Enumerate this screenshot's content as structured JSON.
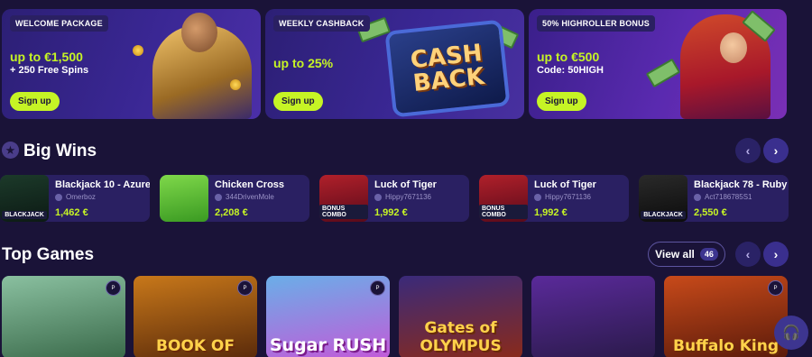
{
  "promos": [
    {
      "tag": "WELCOME PACKAGE",
      "headline": "up to €1,500",
      "subline": "+ 250 Free Spins",
      "button": "Sign up"
    },
    {
      "tag": "WEEKLY CASHBACK",
      "headline": "up to 25%",
      "subline": "",
      "button": "Sign up",
      "art_text": [
        "CASH",
        "BACK"
      ]
    },
    {
      "tag": "50% HIGHROLLER BONUS",
      "headline": "up to €500",
      "subline": "Code: 50HIGH",
      "button": "Sign up"
    }
  ],
  "big_wins": {
    "title": "Big Wins",
    "icon": "star-icon",
    "items": [
      {
        "game": "Blackjack 10 - Azure",
        "user": "Omerboz",
        "amount": "1,462 €",
        "thumb_label": "BLACKJACK"
      },
      {
        "game": "Chicken Cross",
        "user": "344DrivenMole",
        "amount": "2,208 €",
        "thumb_label": ""
      },
      {
        "game": "Luck of Tiger",
        "user": "Hippy7671136",
        "amount": "1,992 €",
        "thumb_label": "BONUS COMBO"
      },
      {
        "game": "Luck of Tiger",
        "user": "Hippy7671136",
        "amount": "1,992 €",
        "thumb_label": "BONUS COMBO"
      },
      {
        "game": "Blackjack 78 - Ruby",
        "user": "Act7186785S1",
        "amount": "2,550 €",
        "thumb_label": "BLACKJACK"
      }
    ]
  },
  "top_games": {
    "title": "Top Games",
    "view_all": "View all",
    "count": "46",
    "tiles": [
      {
        "title": "",
        "badge": "P"
      },
      {
        "title": "BOOK OF",
        "badge": "P"
      },
      {
        "title": "Sugar RUSH",
        "badge": "P"
      },
      {
        "title": "Gates of OLYMPUS",
        "badge": ""
      },
      {
        "title": "",
        "badge": ""
      },
      {
        "title": "Buffalo King",
        "badge": "P"
      }
    ]
  },
  "nav": {
    "prev": "‹",
    "next": "›"
  },
  "colors": {
    "background": "#1a1338",
    "accent": "#c6f425",
    "card": "#2a2062"
  }
}
